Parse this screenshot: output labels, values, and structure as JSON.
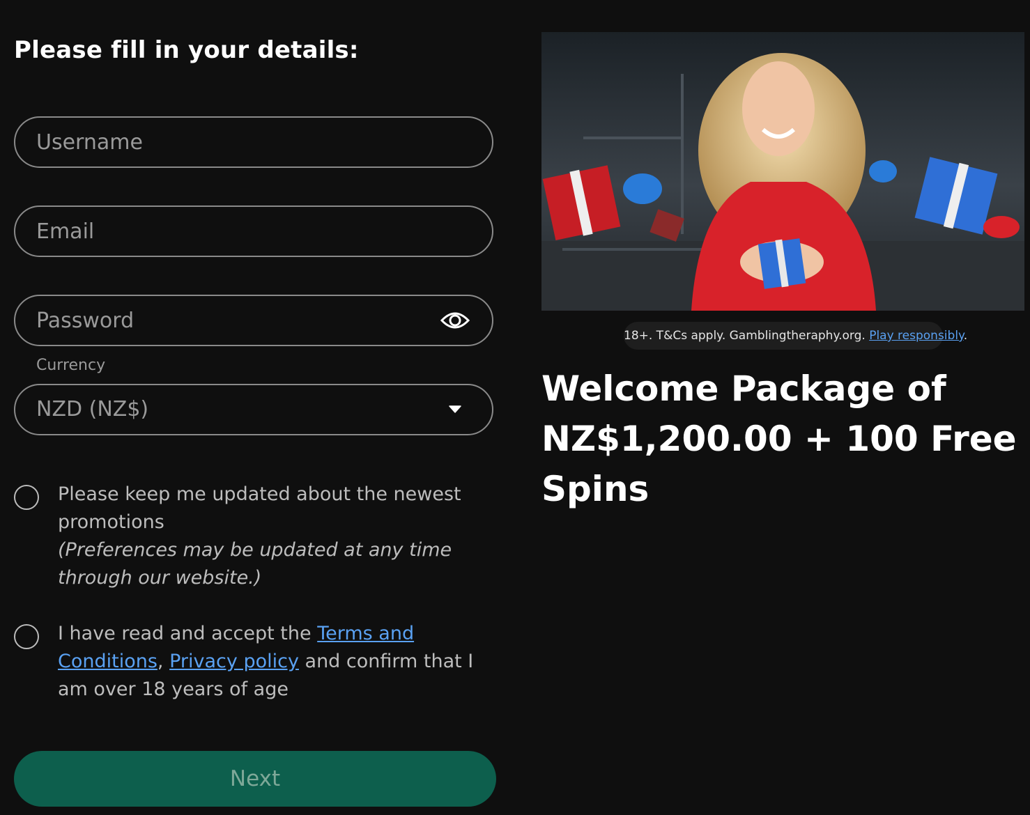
{
  "form": {
    "heading": "Please fill in your details:",
    "username": {
      "placeholder": "Username",
      "value": ""
    },
    "email": {
      "placeholder": "Email",
      "value": ""
    },
    "password": {
      "placeholder": "Password",
      "value": ""
    },
    "currency": {
      "label": "Currency",
      "selected": "NZD (NZ$)"
    },
    "promotions_opt_in": {
      "checked": false,
      "text": "Please keep me updated about the newest promotions",
      "note": "(Preferences may be updated at any time through our website.)"
    },
    "terms": {
      "checked": false,
      "prefix": "I have read and accept the ",
      "terms_link": "Terms and Conditions",
      "separator": ",",
      "privacy_link": "Privacy policy",
      "suffix": " and confirm that I am over 18 years of age"
    },
    "next_label": "Next"
  },
  "promo": {
    "disclaimer_text": "18+. T&Cs apply. Gamblingtheraphy.org. ",
    "disclaimer_link": "Play responsibly",
    "disclaimer_end": ".",
    "title_line1": "Welcome Package of",
    "title_line2": "NZ$1,200.00 + 100 Free Spins"
  },
  "colors": {
    "background": "#0f0f0f",
    "accent_button": "#0d5f4d",
    "link": "#5aa1f2",
    "promo_red": "#d8222a",
    "gift_blue": "#2f6fd6"
  },
  "icons": [
    "eye-icon",
    "caret-down-icon"
  ]
}
